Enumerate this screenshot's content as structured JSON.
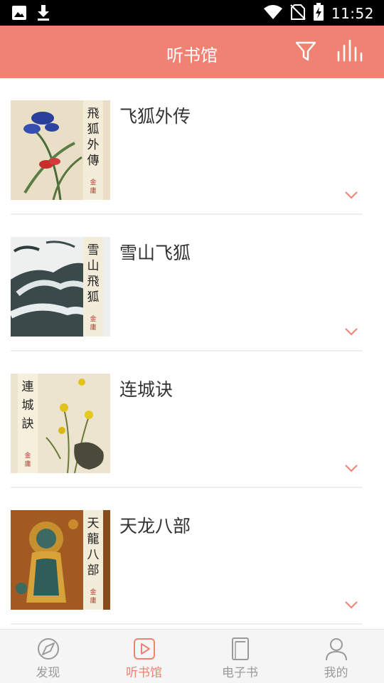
{
  "status_bar": {
    "time": "11:52",
    "left_icons": [
      "image-icon",
      "download-icon"
    ],
    "right_icons": [
      "wifi-icon",
      "no-sim-icon",
      "battery-charging-icon"
    ]
  },
  "header": {
    "title": "听书馆",
    "background": "#ef8272",
    "actions": [
      "filter-icon",
      "bar-chart-icon"
    ]
  },
  "books": [
    {
      "title": "飞狐外传",
      "cover_text": "飛狐外傳",
      "cover_author": "金庸"
    },
    {
      "title": "雪山飞狐",
      "cover_text": "雪山飛狐",
      "cover_author": "金庸"
    },
    {
      "title": "连城诀",
      "cover_text": "連城訣",
      "cover_author": "金庸"
    },
    {
      "title": "天龙八部",
      "cover_text": "天龍八部",
      "cover_author": "金庸"
    }
  ],
  "bottom_nav": {
    "items": [
      {
        "label": "发现",
        "icon": "compass-icon",
        "active": false
      },
      {
        "label": "听书馆",
        "icon": "play-icon",
        "active": true
      },
      {
        "label": "电子书",
        "icon": "ebook-icon",
        "active": false
      },
      {
        "label": "我的",
        "icon": "user-icon",
        "active": false
      }
    ]
  },
  "colors": {
    "accent": "#ef8272",
    "text": "#333333",
    "inactive": "#9a9a9a"
  }
}
